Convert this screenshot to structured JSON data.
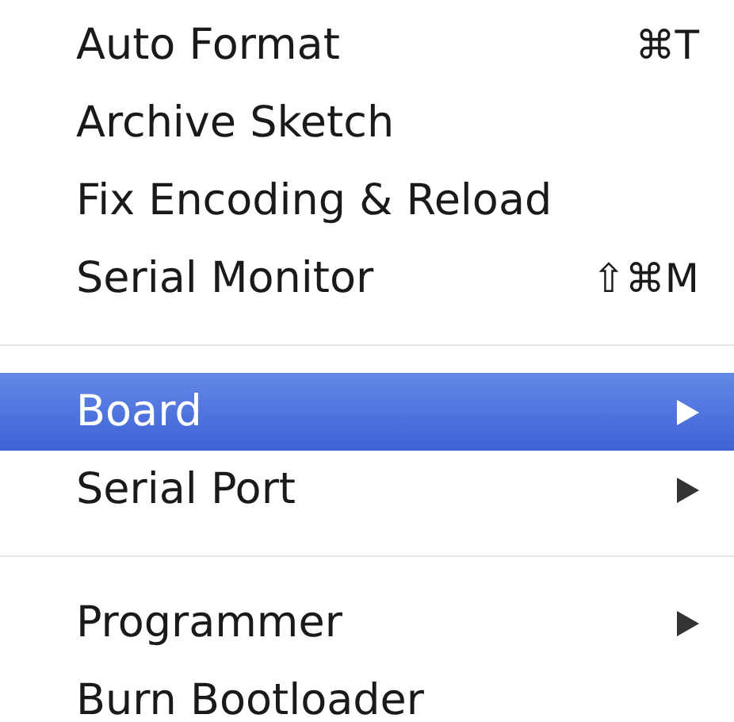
{
  "menu": {
    "items": [
      {
        "kind": "item",
        "label": "Auto Format",
        "shortcut": "⌘T",
        "submenu": false,
        "selected": false
      },
      {
        "kind": "item",
        "label": "Archive Sketch",
        "submenu": false,
        "selected": false
      },
      {
        "kind": "item",
        "label": "Fix Encoding & Reload",
        "submenu": false,
        "selected": false
      },
      {
        "kind": "item",
        "label": "Serial Monitor",
        "shortcut": "⇧⌘M",
        "submenu": false,
        "selected": false
      },
      {
        "kind": "separator"
      },
      {
        "kind": "item",
        "label": "Board",
        "submenu": true,
        "selected": true
      },
      {
        "kind": "item",
        "label": "Serial Port",
        "submenu": true,
        "selected": false
      },
      {
        "kind": "separator"
      },
      {
        "kind": "item",
        "label": "Programmer",
        "submenu": true,
        "selected": false
      },
      {
        "kind": "item",
        "label": "Burn Bootloader",
        "submenu": false,
        "selected": false
      }
    ]
  }
}
